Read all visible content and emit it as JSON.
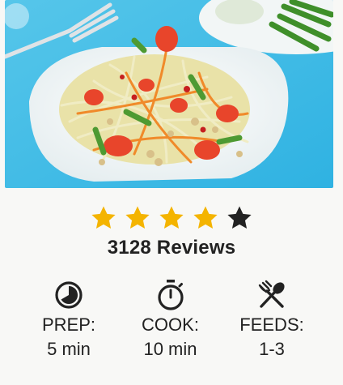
{
  "rating": {
    "stars_filled": 4,
    "stars_total": 5,
    "filled_color": "#f4b400",
    "empty_color": "#222222",
    "reviews_text": "3128 Reviews"
  },
  "stats": [
    {
      "icon": "timer-pie-icon",
      "label": "PREP:",
      "value": "5 min"
    },
    {
      "icon": "stopwatch-icon",
      "label": "COOK:",
      "value": "10 min"
    },
    {
      "icon": "fork-spoon-icon",
      "label": "FEEDS:",
      "value": "1-3"
    }
  ]
}
